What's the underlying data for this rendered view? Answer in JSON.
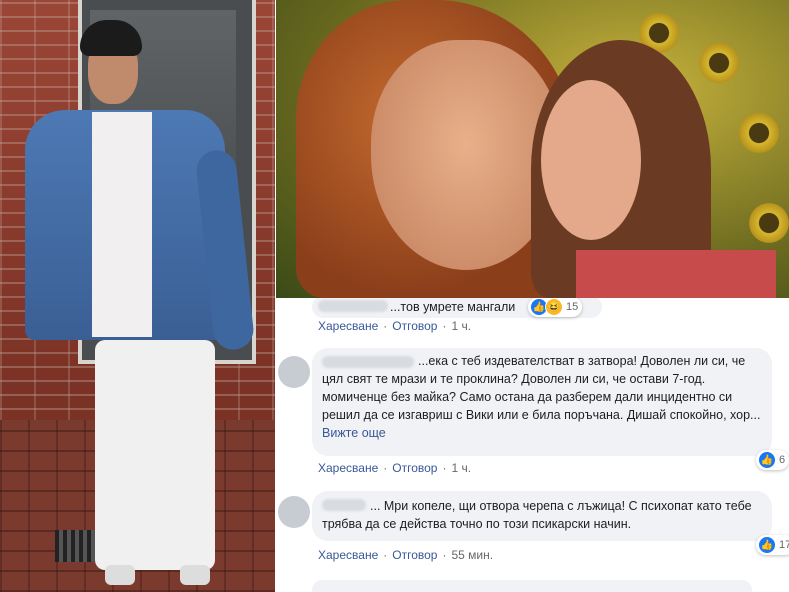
{
  "comments": [
    {
      "text": "...тов умрете мангали",
      "reaction_count": "15",
      "like_label": "Харесване",
      "reply_label": "Отговор",
      "time": "1 ч."
    },
    {
      "text": "...ека с теб издевателстват в затвора! Доволен ли си, че цял свят те мрази и те проклина? Доволен ли си, че остави 7-год. момиченце без майка? Само остана да разберем дали инцидентно си решил да се изгавриш с Вики или е била поръчана. Дишай спокойно, хор...",
      "see_more": "Вижте още",
      "reaction_count": "6",
      "like_label": "Харесване",
      "reply_label": "Отговор",
      "time": "1 ч."
    },
    {
      "text": "... Мри копеле, щи отвора черепа с лъжица! С психопат като тебе трябва да се действа точно по този псикарски начин.",
      "reaction_count": "17",
      "like_label": "Харесване",
      "reply_label": "Отговор",
      "time": "55 мин."
    }
  ],
  "icons": {
    "like": "like-icon",
    "haha": "haha-icon"
  },
  "colors": {
    "link": "#385898",
    "meta": "#65676b",
    "bubble": "#f0f2f5",
    "like_blue": "#1877f2"
  }
}
